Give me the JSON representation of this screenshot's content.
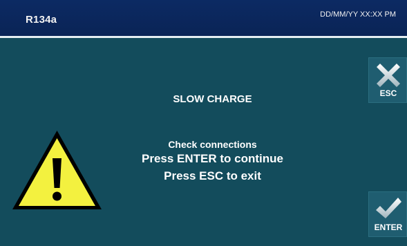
{
  "header": {
    "refrigerant": "R134a",
    "datetime": "DD/MM/YY XX:XX PM"
  },
  "message": {
    "title": "SLOW CHARGE",
    "line1": "Check connections",
    "line2": "Press ENTER to continue",
    "line3": "Press ESC to exit"
  },
  "buttons": {
    "esc_label": "ESC",
    "enter_label": "ENTER"
  },
  "icons": {
    "warning": "warning-icon",
    "esc": "close-icon",
    "enter": "check-icon"
  },
  "colors": {
    "header_bg": "#0c2a63",
    "screen_bg": "#134c5c",
    "warning_fill": "#f3f13f"
  }
}
